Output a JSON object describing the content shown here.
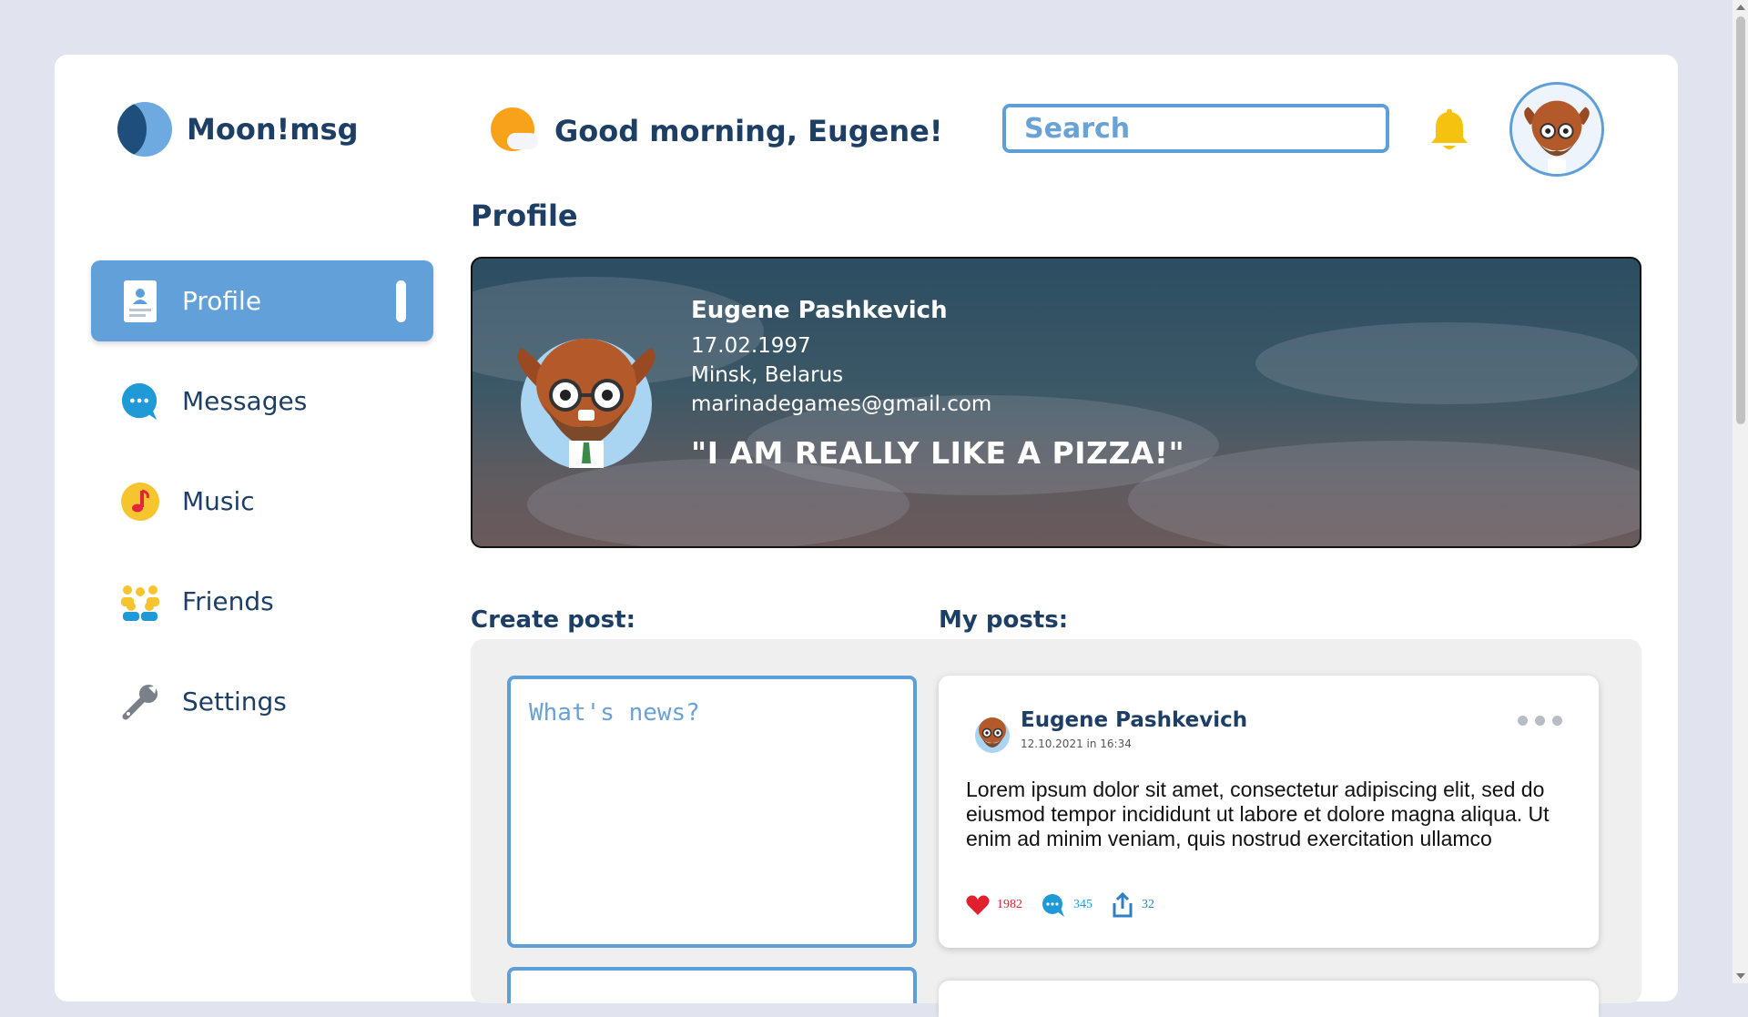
{
  "app": {
    "name": "Moon!msg"
  },
  "header": {
    "greeting": "Good morning, Eugene!",
    "search_placeholder": "Search"
  },
  "sidebar": {
    "items": [
      {
        "label": "Profile",
        "icon": "profile-card-icon",
        "active": true
      },
      {
        "label": "Messages",
        "icon": "chat-bubble-icon",
        "active": false
      },
      {
        "label": "Music",
        "icon": "music-note-icon",
        "active": false
      },
      {
        "label": "Friends",
        "icon": "friends-icon",
        "active": false
      },
      {
        "label": "Settings",
        "icon": "wrench-icon",
        "active": false
      }
    ]
  },
  "profile": {
    "section_title": "Profile",
    "name": "Eugene Pashkevich",
    "birthdate": "17.02.1997",
    "location": "Minsk, Belarus",
    "email": "marinadegames@gmail.com",
    "quote": "\"I AM REALLY LIKE A PIZZA!\""
  },
  "create_post": {
    "title": "Create post:",
    "placeholder": "What's news?"
  },
  "my_posts": {
    "title": "My posts:",
    "posts": [
      {
        "author": "Eugene Pashkevich",
        "date": "12.10.2021 in 16:34",
        "text": "Lorem ipsum dolor sit amet, consectetur adipiscing elit, sed do eiusmod tempor incididunt ut labore et dolore magna aliqua. Ut enim ad minim veniam, quis nostrud exercitation ullamco",
        "likes": "1982",
        "comments": "345",
        "shares": "32"
      }
    ]
  },
  "colors": {
    "page_bg": "#e1e3ee",
    "accent": "#62a0da",
    "text_dark": "#1d3f66",
    "like": "#e0202e",
    "comment": "#1f9ad6",
    "share": "#2f7fc4"
  }
}
